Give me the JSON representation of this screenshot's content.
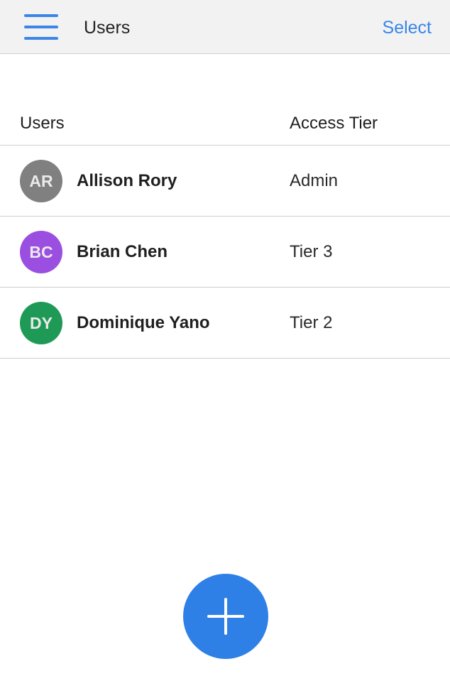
{
  "header": {
    "title": "Users",
    "select_label": "Select",
    "menu_icon": "hamburger-menu-icon"
  },
  "table": {
    "columns": [
      "Users",
      "Access Tier"
    ],
    "rows": [
      {
        "initials": "AR",
        "name": "Allison Rory",
        "tier": "Admin",
        "avatar_color": "#808080"
      },
      {
        "initials": "BC",
        "name": "Brian Chen",
        "tier": "Tier 3",
        "avatar_color": "#9b4fe0"
      },
      {
        "initials": "DY",
        "name": "Dominique Yano",
        "tier": "Tier 2",
        "avatar_color": "#1e9a56"
      }
    ]
  },
  "fab": {
    "icon": "plus-icon",
    "color": "#2f80e6"
  },
  "colors": {
    "accent": "#3a86e8"
  }
}
